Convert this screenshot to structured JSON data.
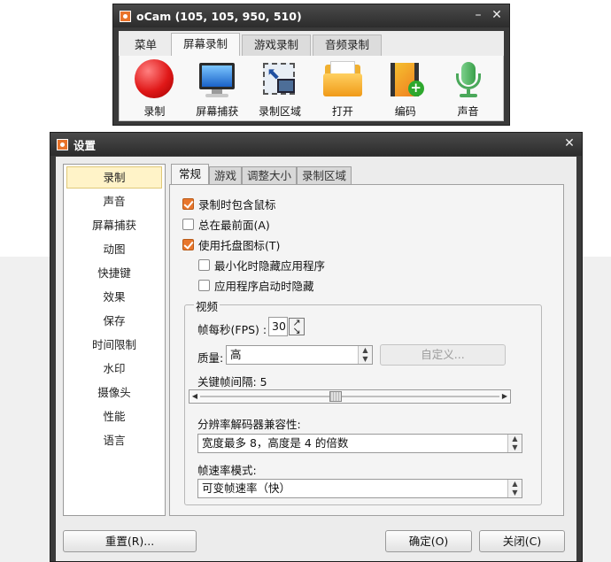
{
  "ocam": {
    "title": "oCam (105, 105, 950, 510)",
    "tabs": [
      "菜单",
      "屏幕录制",
      "游戏录制",
      "音频录制"
    ],
    "active_tab": "屏幕录制",
    "tools": [
      {
        "label": "录制",
        "icon": "record-icon"
      },
      {
        "label": "屏幕捕获",
        "icon": "screen-capture-icon"
      },
      {
        "label": "录制区域",
        "icon": "record-area-icon"
      },
      {
        "label": "打开",
        "icon": "open-folder-icon"
      },
      {
        "label": "编码",
        "icon": "encode-icon"
      },
      {
        "label": "声音",
        "icon": "microphone-icon"
      }
    ]
  },
  "settings": {
    "title": "设置",
    "categories": [
      "录制",
      "声音",
      "屏幕捕获",
      "动图",
      "快捷键",
      "效果",
      "保存",
      "时间限制",
      "水印",
      "摄像头",
      "性能",
      "语言"
    ],
    "active_category": "录制",
    "tabs": [
      "常规",
      "游戏",
      "调整大小",
      "录制区域"
    ],
    "active_tab": "常规",
    "options": {
      "include_cursor": {
        "label": "录制时包含鼠标",
        "checked": true
      },
      "always_on_top": {
        "label": "总在最前面(A)",
        "checked": false
      },
      "tray_icon": {
        "label": "使用托盘图标(T)",
        "checked": true
      },
      "hide_on_minimize": {
        "label": "最小化时隐藏应用程序",
        "checked": false
      },
      "hide_on_start": {
        "label": "应用程序启动时隐藏",
        "checked": false
      }
    },
    "video": {
      "group_label": "视频",
      "fps_label": "帧每秒(FPS) :",
      "fps_value": "30",
      "quality_label": "质量:",
      "quality_value": "高",
      "custom_button": "自定义...",
      "keyframe_label": "关键帧间隔: 5",
      "keyframe_value": 5,
      "keyframe_slider_fraction": 0.45,
      "codec_compat_label": "分辨率解码器兼容性:",
      "codec_compat_value": "宽度最多 8，高度是 4 的倍数",
      "framerate_mode_label": "帧速率模式:",
      "framerate_mode_value": "可变帧速率（快）"
    },
    "buttons": {
      "reset": "重置(R)...",
      "ok": "确定(O)",
      "close": "关闭(C)"
    }
  },
  "colors": {
    "titlebar": "#333333",
    "accent_checkbox": "#e8762c",
    "selected_category": "#fff3c8"
  }
}
